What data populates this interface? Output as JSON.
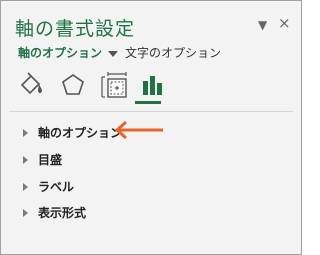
{
  "pane": {
    "title": "軸の書式設定",
    "dropdown_icon": "chevron-down",
    "close_label": "×"
  },
  "subtabs": {
    "active": "軸のオプション",
    "other": "文字のオプション"
  },
  "icons": [
    "paint-bucket-icon",
    "pentagon-icon",
    "size-properties-icon",
    "bar-chart-icon"
  ],
  "sections": [
    {
      "label": "軸のオプション"
    },
    {
      "label": "目盛"
    },
    {
      "label": "ラベル"
    },
    {
      "label": "表示形式"
    }
  ],
  "colors": {
    "accent": "#217346",
    "arrow": "#e8642c"
  }
}
